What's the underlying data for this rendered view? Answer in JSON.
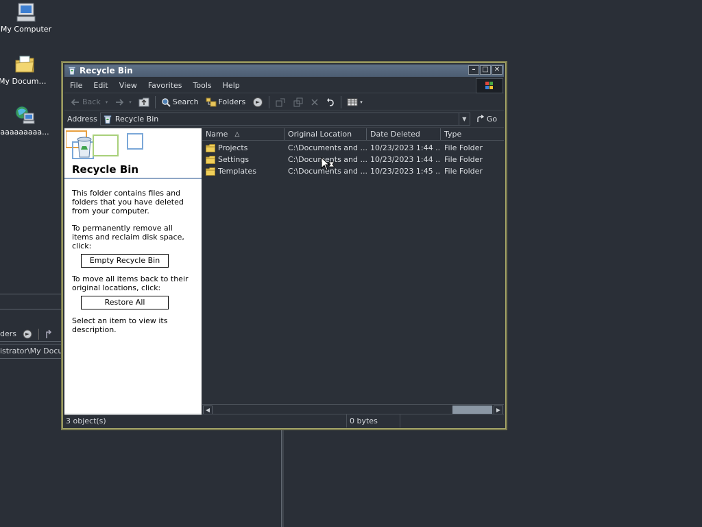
{
  "desktop": {
    "icons": [
      {
        "label": "My Computer",
        "icon": "computer-icon"
      },
      {
        "label": "My Documents",
        "icon": "folder-documents-icon"
      },
      {
        "label": "aaaaaaaaa..."
      }
    ],
    "background_fragments": {
      "toolbar_text": "ders",
      "address_text": "istrator\\My Docum"
    }
  },
  "window": {
    "title": "Recycle Bin",
    "menu": [
      "File",
      "Edit",
      "View",
      "Favorites",
      "Tools",
      "Help"
    ],
    "toolbar": {
      "back": "Back",
      "search": "Search",
      "folders": "Folders"
    },
    "address": {
      "label": "Address",
      "value": "Recycle Bin",
      "go": "Go"
    },
    "left_pane": {
      "title": "Recycle Bin",
      "text1": "This folder contains files and folders that you have deleted from your computer.",
      "text2": "To permanently remove all items and reclaim disk space, click:",
      "empty_button": "Empty Recycle Bin",
      "text3": "To move all items back to their original locations, click:",
      "restore_button": "Restore All",
      "text4": "Select an item to view its description."
    },
    "columns": [
      "Name",
      "Original Location",
      "Date Deleted",
      "Type"
    ],
    "files": [
      {
        "name": "Projects",
        "location": "C:\\Documents and ...",
        "date": "10/23/2023 1:44 ...",
        "type": "File Folder"
      },
      {
        "name": "Settings",
        "location": "C:\\Documents and ...",
        "date": "10/23/2023 1:44 ...",
        "type": "File Folder"
      },
      {
        "name": "Templates",
        "location": "C:\\Documents and ...",
        "date": "10/23/2023 1:45 ...",
        "type": "File Folder"
      }
    ],
    "status": {
      "objects": "3 object(s)",
      "size": "0 bytes"
    }
  },
  "colors": {
    "titlebar": "#5f7188",
    "desktop": "#2a2f37",
    "window_border": "#7c7c4f"
  }
}
